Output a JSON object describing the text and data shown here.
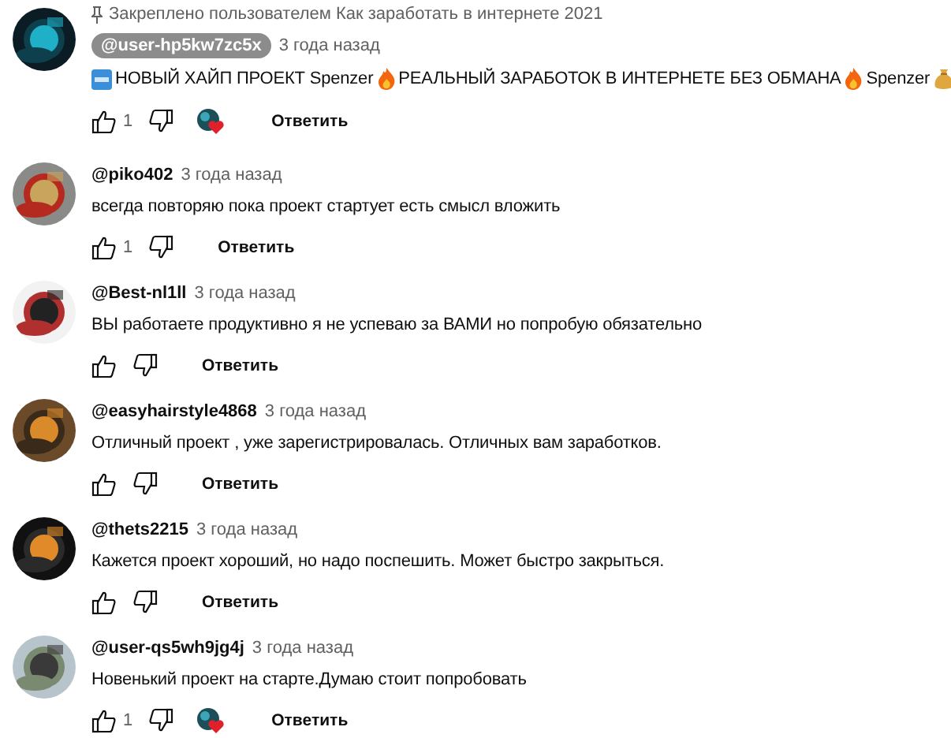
{
  "comments": [
    {
      "pinned_note": "Закреплено пользователем Как заработать в интернете 2021",
      "author": "@user-hp5kw7zc5x",
      "author_highlighted": true,
      "time": "3 года назад",
      "body_parts": [
        "НОВЫЙ ХАЙП ПРОЕКТ Spenzer",
        "РЕАЛЬНЫЙ ЗАРАБОТОК В ИНТЕРНЕТЕ БЕЗ ОБМАНА",
        "Spenzer"
      ],
      "likes": "1",
      "creator_heart": true,
      "reply": "Ответить"
    },
    {
      "author": "@piko402",
      "author_highlighted": false,
      "time": "3 года назад",
      "body_parts": [
        "всегда повторяю пока проект стартует есть смысл вложить"
      ],
      "likes": "1",
      "creator_heart": false,
      "reply": "Ответить"
    },
    {
      "author": "@Best-nl1ll",
      "author_highlighted": false,
      "time": "3 года назад",
      "body_parts": [
        "ВЫ работаете продуктивно я не успеваю за ВАМИ но попробую обязательно"
      ],
      "creator_heart": false,
      "reply": "Ответить"
    },
    {
      "author": "@easyhairstyle4868",
      "author_highlighted": false,
      "time": "3 года назад",
      "body_parts": [
        "Отличный проект , уже зарегистрировалась. Отличных вам заработков."
      ],
      "creator_heart": false,
      "reply": "Ответить"
    },
    {
      "author": "@thets2215",
      "author_highlighted": false,
      "time": "3 года назад",
      "body_parts": [
        "Кажется проект хороший, но надо поспешить. Может быстро закрыться."
      ],
      "creator_heart": false,
      "reply": "Ответить"
    },
    {
      "author": "@user-qs5wh9jg4j",
      "author_highlighted": false,
      "time": "3 года назад",
      "body_parts": [
        "Новенький проект на старте.Думаю стоит попробовать"
      ],
      "likes": "1",
      "creator_heart": true,
      "reply": "Ответить"
    }
  ]
}
